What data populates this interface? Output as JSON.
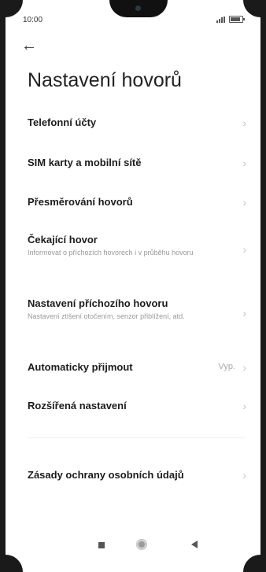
{
  "status": {
    "time": "10:00"
  },
  "icons": {
    "back": "back-arrow-icon",
    "chevron": "chevron-right-icon",
    "signal": "signal-icon",
    "battery": "battery-icon"
  },
  "page": {
    "title": "Nastavení hovorů"
  },
  "items": [
    {
      "title": "Telefonní účty",
      "subtitle": ""
    },
    {
      "title": "SIM karty a mobilní sítě",
      "subtitle": ""
    },
    {
      "title": "Přesměrování hovorů",
      "subtitle": ""
    },
    {
      "title": "Čekající hovor",
      "subtitle": "Informovat o příchozích hovorech i v průběhu hovoru"
    },
    {
      "title": "Nastavení příchozího hovoru",
      "subtitle": "Nastavení ztišení otočením, senzor přiblížení, atd."
    },
    {
      "title": "Automaticky přijmout",
      "subtitle": "",
      "value": "Vyp."
    },
    {
      "title": "Rozšířená nastavení",
      "subtitle": ""
    },
    {
      "title": "Zásady ochrany osobních údajů",
      "subtitle": ""
    }
  ],
  "chevron_glyph": "›",
  "back_glyph": "←"
}
